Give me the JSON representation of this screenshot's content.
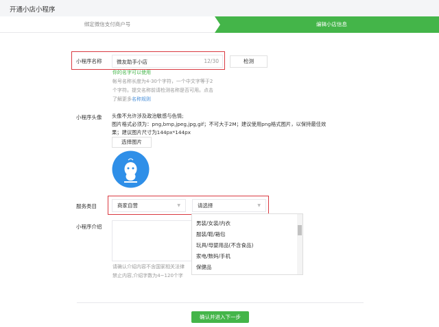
{
  "header": {
    "title": "开通小店小程序"
  },
  "steps": [
    {
      "label": "绑定微信支付商户号",
      "active": false
    },
    {
      "label": "编辑小店信息",
      "active": true
    }
  ],
  "name": {
    "label": "小程序名称",
    "value": "微友助手小店",
    "count": "12/30",
    "check_button": "检测",
    "ok_text": "你的名字可以使用",
    "help": [
      "帐号名称长度为4-30个字符，一个中文字等于2",
      "个字符。提交名称前请检测名称是否可用。点击"
    ],
    "help_prefix": "了解更多",
    "rules_link": "名称规则"
  },
  "avatar": {
    "label": "小程序头像",
    "lines": [
      "头像不允许涉及政治敏感与色情;",
      "图片格式必须为：png,bmp,jpeg,jpg,gif；不可大于2M；建议使用png格式图片，以保持最佳效",
      "果；建议图片尺寸为144px*144px"
    ],
    "choose_button": "选择图片"
  },
  "service": {
    "label": "服务类目",
    "select1": "商家自营",
    "select2": "请选择",
    "options": [
      "男装/女装/内衣",
      "服装/鞋/箱包",
      "玩具/母婴用品(不含食品)",
      "家电/数码/手机",
      "保健品"
    ]
  },
  "intro": {
    "label": "小程序介绍",
    "help": [
      "请确认介绍内容不含国家相关法律",
      "禁止内容,介绍字数为4~120个字"
    ]
  },
  "submit": {
    "label": "确认并进入下一步"
  },
  "colors": {
    "green": "#44b549",
    "red": "#d9363e",
    "link": "#4a90d9",
    "avatar": "#2f8fe8"
  }
}
